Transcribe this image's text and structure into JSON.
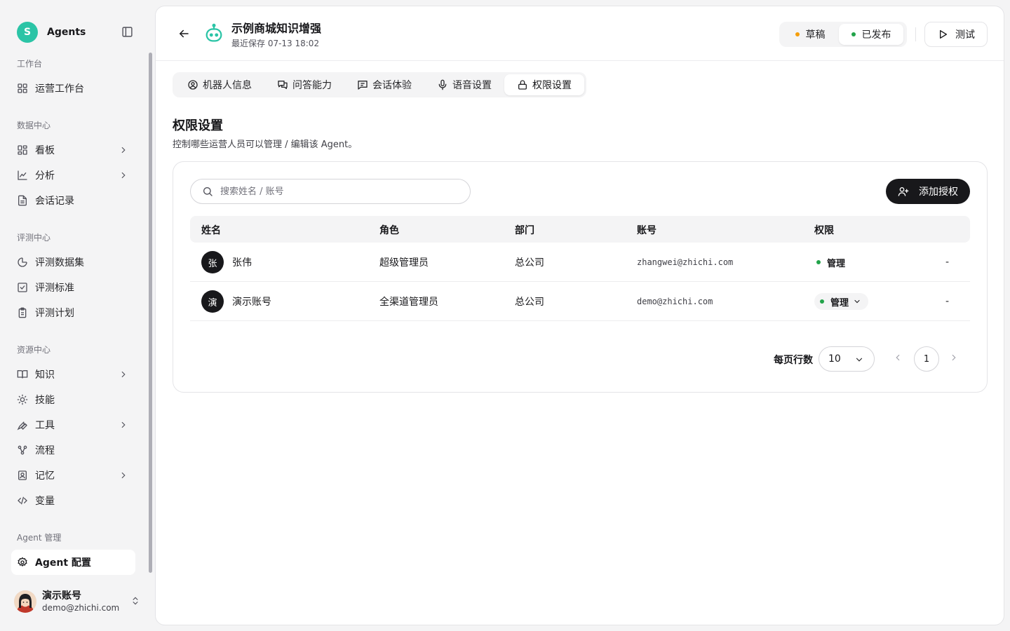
{
  "brand": {
    "logo_letter": "S",
    "name": "Agents",
    "accent": "#2bc4a6"
  },
  "sidebar": {
    "sections": [
      {
        "title": "工作台",
        "items": [
          {
            "label": "运营工作台",
            "icon": "dashboard-icon"
          }
        ]
      },
      {
        "title": "数据中心",
        "items": [
          {
            "label": "看板",
            "icon": "board-icon",
            "has_children": true
          },
          {
            "label": "分析",
            "icon": "chart-icon",
            "has_children": true
          },
          {
            "label": "会话记录",
            "icon": "document-icon"
          }
        ]
      },
      {
        "title": "评测中心",
        "items": [
          {
            "label": "评测数据集",
            "icon": "pie-icon"
          },
          {
            "label": "评测标准",
            "icon": "checkbox-icon"
          },
          {
            "label": "评测计划",
            "icon": "clipboard-icon"
          }
        ]
      },
      {
        "title": "资源中心",
        "items": [
          {
            "label": "知识",
            "icon": "book-icon",
            "has_children": true
          },
          {
            "label": "技能",
            "icon": "sun-icon"
          },
          {
            "label": "工具",
            "icon": "wrench-icon",
            "has_children": true
          },
          {
            "label": "流程",
            "icon": "workflow-icon"
          },
          {
            "label": "记忆",
            "icon": "memory-icon",
            "has_children": true
          },
          {
            "label": "变量",
            "icon": "code-icon"
          }
        ]
      },
      {
        "title": "Agent 管理",
        "items": [
          {
            "label": "Agent 配置",
            "icon": "gear-icon",
            "active": true
          }
        ]
      }
    ]
  },
  "user": {
    "name": "演示账号",
    "email": "demo@zhichi.com"
  },
  "header": {
    "title": "示例商城知识增强",
    "saved": "最近保存 07-13 18:02",
    "status_draft": "草稿",
    "status_published": "已发布",
    "draft_color": "#f59e0b",
    "published_color": "#22a34a",
    "test_label": "测试"
  },
  "tabs": [
    {
      "label": "机器人信息",
      "icon": "user-circle-icon"
    },
    {
      "label": "问答能力",
      "icon": "chat-bubbles-icon"
    },
    {
      "label": "会话体验",
      "icon": "message-square-icon"
    },
    {
      "label": "语音设置",
      "icon": "mic-icon"
    },
    {
      "label": "权限设置",
      "icon": "lock-icon",
      "active": true
    }
  ],
  "page": {
    "title": "权限设置",
    "description": "控制哪些运营人员可以管理 / 编辑该 Agent。"
  },
  "search": {
    "placeholder": "搜索姓名 / 账号"
  },
  "add_button": "添加授权",
  "table": {
    "columns": [
      "姓名",
      "角色",
      "部门",
      "账号",
      "权限"
    ],
    "rows": [
      {
        "avatar": "张",
        "name": "张伟",
        "role": "超级管理员",
        "dept": "总公司",
        "account": "zhangwei@zhichi.com",
        "permission": "管理",
        "action": "-"
      },
      {
        "avatar": "演",
        "name": "演示账号",
        "role": "全渠道管理员",
        "dept": "总公司",
        "account": "demo@zhichi.com",
        "permission": "管理",
        "action": "-"
      }
    ]
  },
  "pagination": {
    "rows_label": "每页行数",
    "page_size": "10",
    "current_page": "1"
  }
}
